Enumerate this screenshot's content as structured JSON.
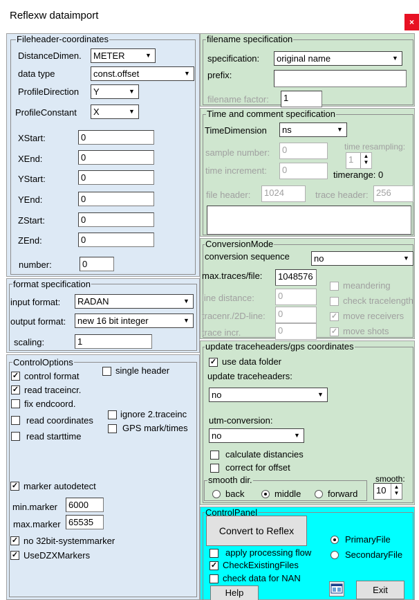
{
  "window": {
    "title": "Reflexw dataimport",
    "close_glyph": "×"
  },
  "fileheader": {
    "legend": "Fileheader-coordinates",
    "distance_dim_label": "DistanceDimen.",
    "distance_dim_value": "METER",
    "data_type_label": "data type",
    "data_type_value": "const.offset",
    "profile_direction_label": "ProfileDirection",
    "profile_direction_value": "Y",
    "profile_constant_label": "ProfileConstant",
    "profile_constant_value": "X",
    "xstart_label": "XStart:",
    "xstart": "0",
    "xend_label": "XEnd:",
    "xend": "0",
    "ystart_label": "YStart:",
    "ystart": "0",
    "yend_label": "YEnd:",
    "yend": "0",
    "zstart_label": "ZStart:",
    "zstart": "0",
    "zend_label": "ZEnd:",
    "zend": "0",
    "number_label": "number:",
    "number": "0"
  },
  "format": {
    "legend": "format specification",
    "input_label": "input format:",
    "input_value": "RADAN",
    "output_label": "output format:",
    "output_value": "new 16 bit integer",
    "scaling_label": "scaling:",
    "scaling": "1"
  },
  "control_options": {
    "legend": "ControlOptions",
    "single_header": "single header",
    "control_format": "control format",
    "read_traceincr": "read traceincr.",
    "fix_endcoord": "fix endcoord.",
    "ignore_traceinc": "ignore 2.traceinc",
    "read_coordinates": "read coordinates",
    "gps_mark": "GPS mark/times",
    "read_starttime": "read starttime",
    "marker_autodetect": "marker autodetect",
    "min_marker_label": "min.marker",
    "min_marker": "6000",
    "max_marker_label": "max.marker",
    "max_marker": "65535",
    "no_32bit": "no 32bit-systemmarker",
    "use_dzx": "UseDZXMarkers"
  },
  "filename": {
    "legend": "filename specification",
    "spec_label": "specification:",
    "spec_value": "original name",
    "prefix_label": "prefix:",
    "prefix": "",
    "factor_label": "filename factor:",
    "factor": "1"
  },
  "time": {
    "legend": "Time and comment specification",
    "dim_label": "TimeDimension",
    "dim_value": "ns",
    "sample_number_label": "sample number:",
    "sample_number": "0",
    "resampling_label": "time resampling:",
    "resampling": "1",
    "increment_label": "time increment:",
    "increment": "0",
    "timerange": "timerange: 0",
    "file_header_label": "file header:",
    "file_header": "1024",
    "trace_header_label": "trace header:",
    "trace_header": "256",
    "comment": ""
  },
  "conversion": {
    "legend": "ConversionMode",
    "sequence_label": "conversion sequence",
    "sequence_value": "no",
    "max_traces_label": "max.traces/file:",
    "max_traces": "1048576",
    "meandering": "meandering",
    "line_distance_label": "line distance:",
    "line_distance": "0",
    "check_tracelength": "check tracelength",
    "tracenr_label": "tracenr./2D-line:",
    "tracenr": "0",
    "move_receivers": "move receivers",
    "trace_incr_label": "trace incr.",
    "trace_incr": "0",
    "move_shots": "move shots"
  },
  "update": {
    "legend": "update traceheaders/gps coordinates",
    "use_data_folder": "use data folder",
    "traceheaders_label": "update traceheaders:",
    "traceheaders_value": "no",
    "utm_label": "utm-conversion:",
    "utm_value": "no",
    "calc_distancies": "calculate distancies",
    "correct_offset": "correct for offset",
    "smooth_dir_legend": "smooth dir.",
    "back": "back",
    "middle": "middle",
    "forward": "forward",
    "smooth_label": "smooth:",
    "smooth": "10"
  },
  "control_panel": {
    "legend": "ControlPanel",
    "convert_button": "Convert to Reflex",
    "primary_file": "PrimaryFile",
    "secondary_file": "SecondaryFile",
    "apply_flow": "apply processing flow",
    "check_existing": "CheckExistingFiles",
    "check_nan": "check data for NAN",
    "help_button": "Help",
    "exit_button": "Exit"
  },
  "colors": {
    "left_panel": "#dde9f5",
    "right_panel": "#cfe6cf",
    "control_panel": "#00ffff",
    "close": "#e81123"
  }
}
